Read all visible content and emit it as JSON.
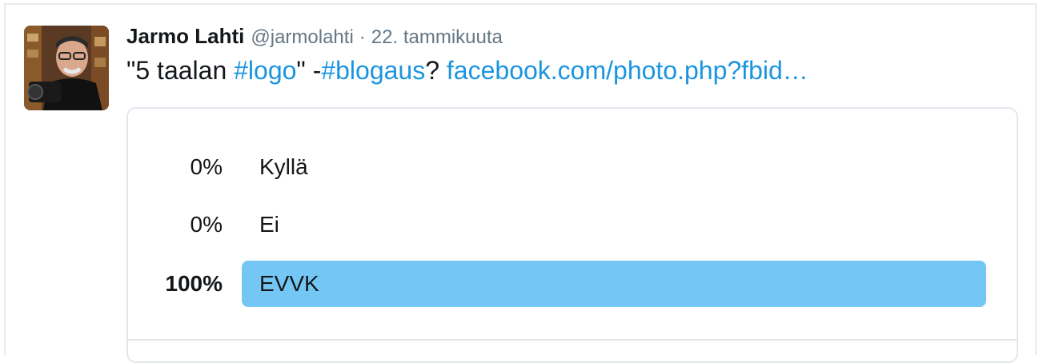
{
  "tweet": {
    "author_name": "Jarmo Lahti",
    "handle": "@jarmolahti",
    "separator": "·",
    "timestamp": "22. tammikuuta",
    "text_prefix": "\"5 taalan ",
    "hashtag1": "#logo",
    "text_mid": "\" -",
    "hashtag2": "#blogaus",
    "text_q": "? ",
    "link": "facebook.com/photo.php?fbid…"
  },
  "poll": {
    "options": [
      {
        "percent_label": "0%",
        "label": "Kyllä",
        "share": 0.0,
        "winner": false
      },
      {
        "percent_label": "0%",
        "label": "Ei",
        "share": 0.0,
        "winner": false
      },
      {
        "percent_label": "100%",
        "label": "EVVK",
        "share": 1.0,
        "winner": true
      }
    ]
  },
  "colors": {
    "link": "#1b95e0",
    "poll_bar": "#74c7f5",
    "muted": "#657786"
  },
  "icons": {
    "avatar": "profile-photo-avatar"
  }
}
